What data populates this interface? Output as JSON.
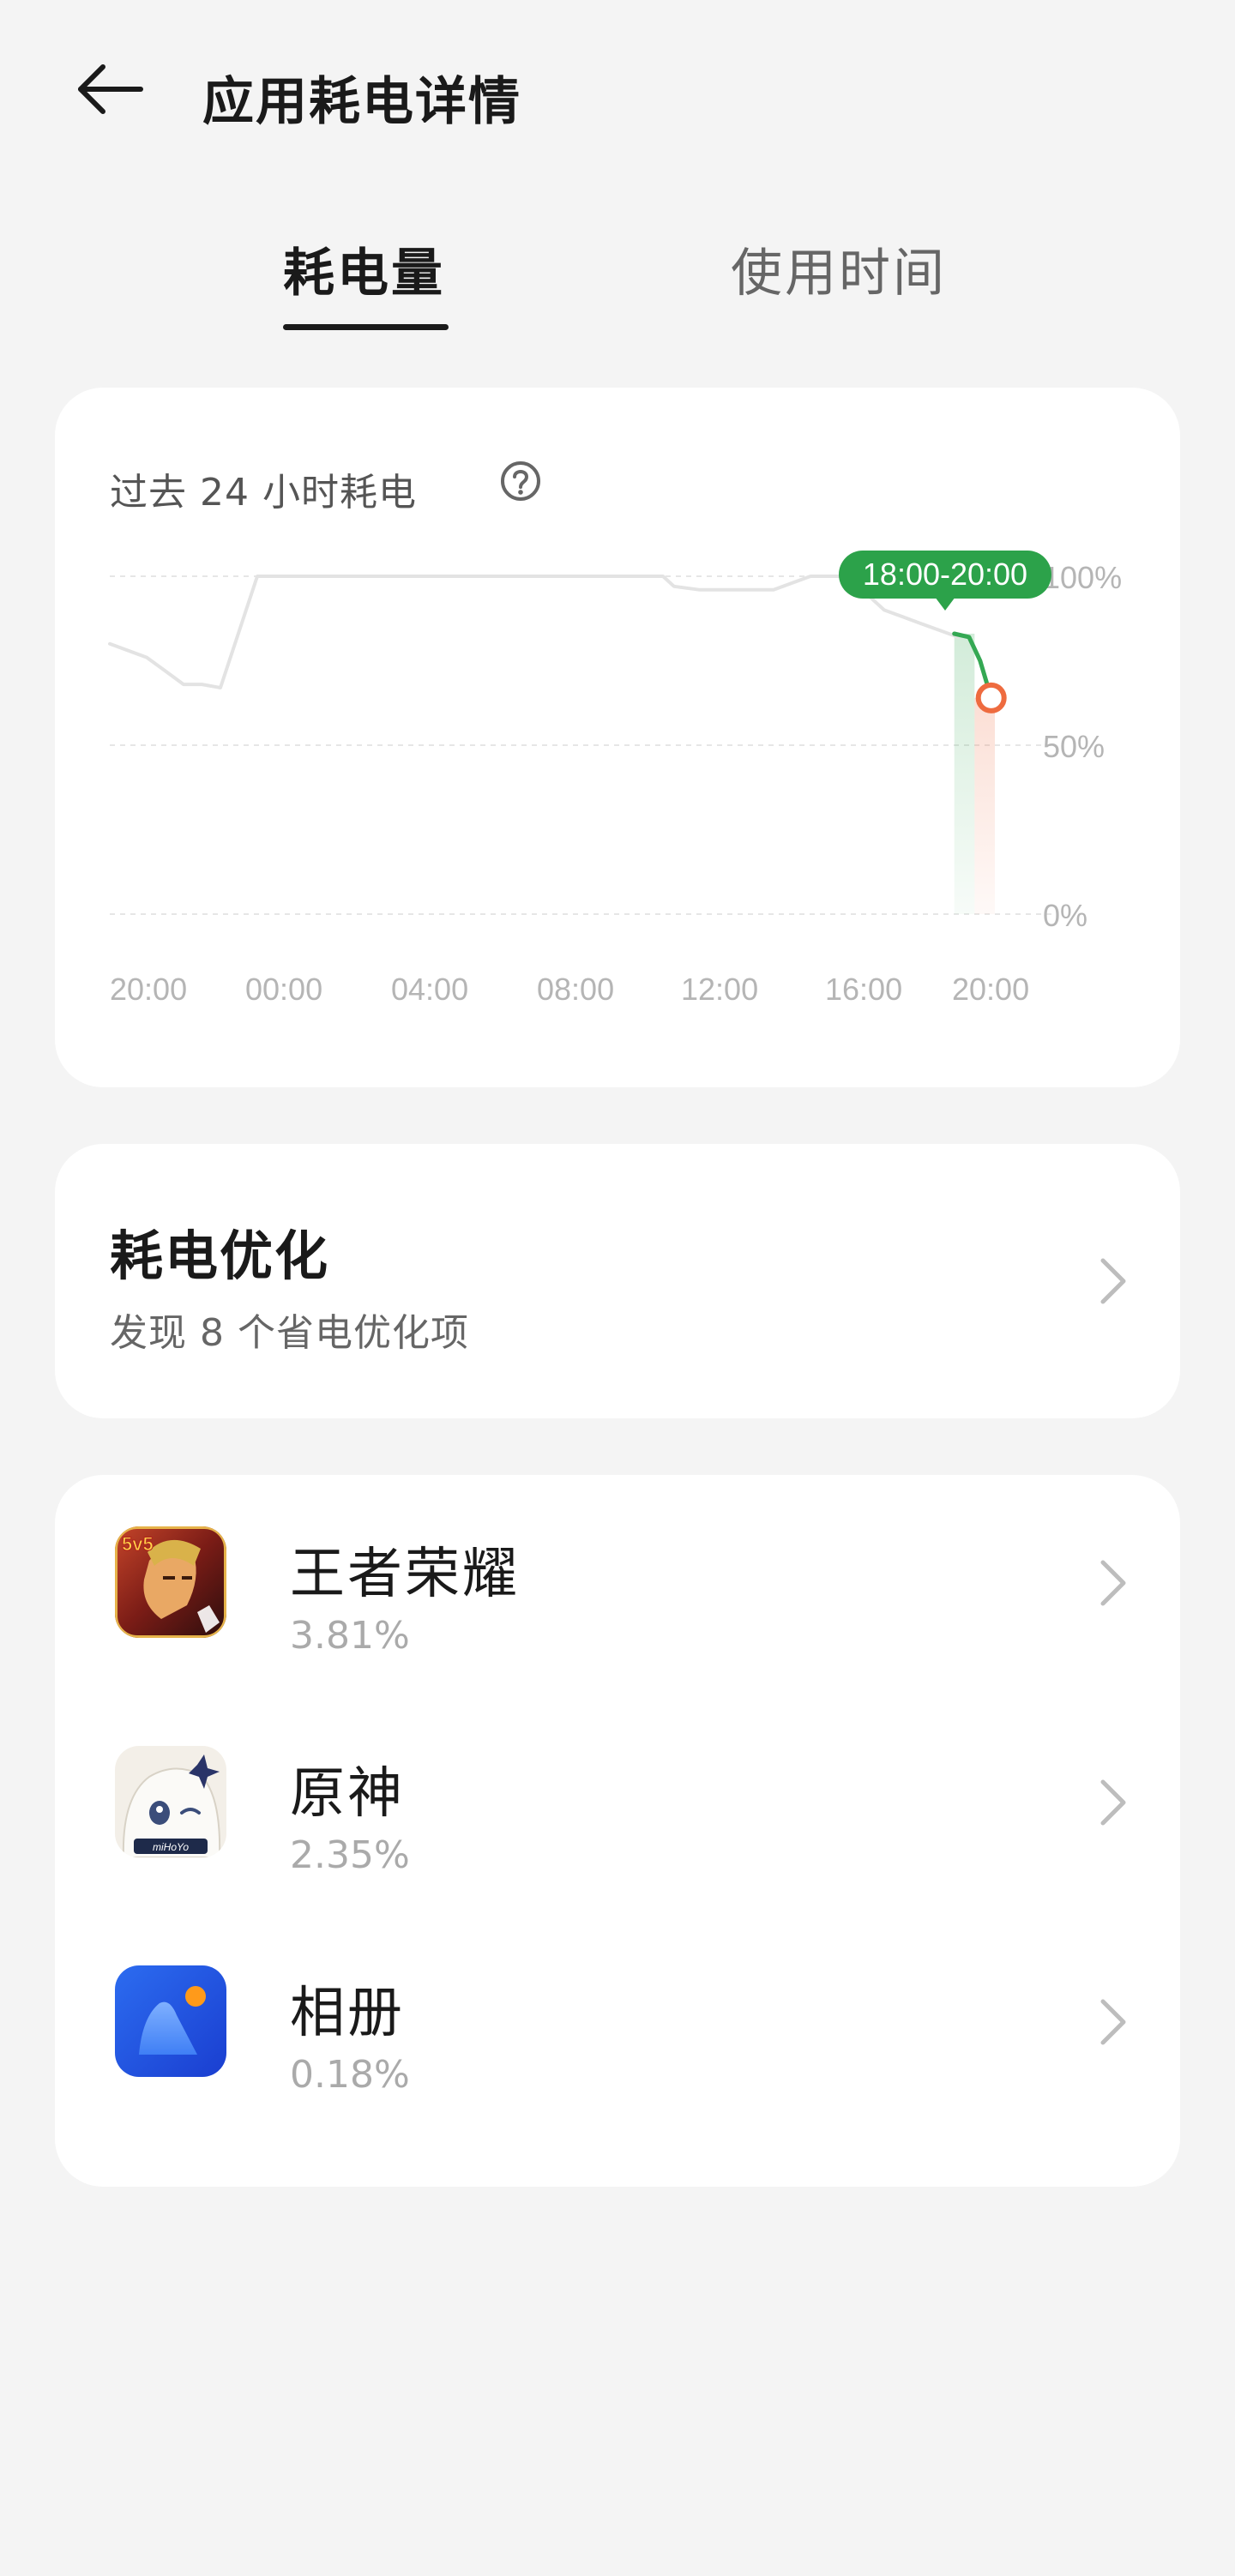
{
  "header": {
    "title": "应用耗电详情",
    "back_icon": "back-arrow-icon"
  },
  "tabs": [
    {
      "label": "耗电量",
      "active": true
    },
    {
      "label": "使用时间",
      "active": false
    }
  ],
  "chart_card": {
    "title": "过去 24 小时耗电",
    "help_icon": "help-icon"
  },
  "chart_data": {
    "type": "line",
    "title": "过去 24 小时耗电",
    "x_ticks": [
      "20:00",
      "00:00",
      "04:00",
      "08:00",
      "12:00",
      "16:00",
      "20:00"
    ],
    "y_ticks": [
      "100%",
      "50%",
      "0%"
    ],
    "ylim": [
      0,
      100
    ],
    "grid": true,
    "highlight_label": "18:00-20:00",
    "series": [
      {
        "hours": [
          0,
          1,
          1.5,
          2,
          2.5,
          3,
          4,
          5,
          6,
          8,
          10,
          12,
          14,
          15,
          15.3,
          16,
          17,
          18,
          19,
          20,
          21,
          21.5,
          22,
          22.5,
          23
        ],
        "values": [
          80,
          76,
          72,
          68,
          68,
          67,
          100,
          100,
          100,
          100,
          100,
          100,
          100,
          100,
          97,
          96,
          96,
          96,
          100,
          100,
          90,
          88,
          86,
          84,
          82
        ]
      }
    ],
    "highlight_series": {
      "hours": [
        22.9,
        23.3,
        23.6,
        23.9
      ],
      "values": [
        83,
        82,
        75,
        64
      ]
    },
    "colors": {
      "line": "#e3e3e3",
      "highlight": "#34a853",
      "endpoint": "#ee6b3f",
      "label_bg": "#2ca24a"
    }
  },
  "optimization": {
    "title": "耗电优化",
    "subtitle": "发现 8 个省电优化项"
  },
  "apps": [
    {
      "name": "王者荣耀",
      "percent": "3.81%",
      "icon": "honor-of-kings-icon"
    },
    {
      "name": "原神",
      "percent": "2.35%",
      "icon": "genshin-impact-icon"
    },
    {
      "name": "相册",
      "percent": "0.18%",
      "icon": "gallery-icon"
    }
  ]
}
